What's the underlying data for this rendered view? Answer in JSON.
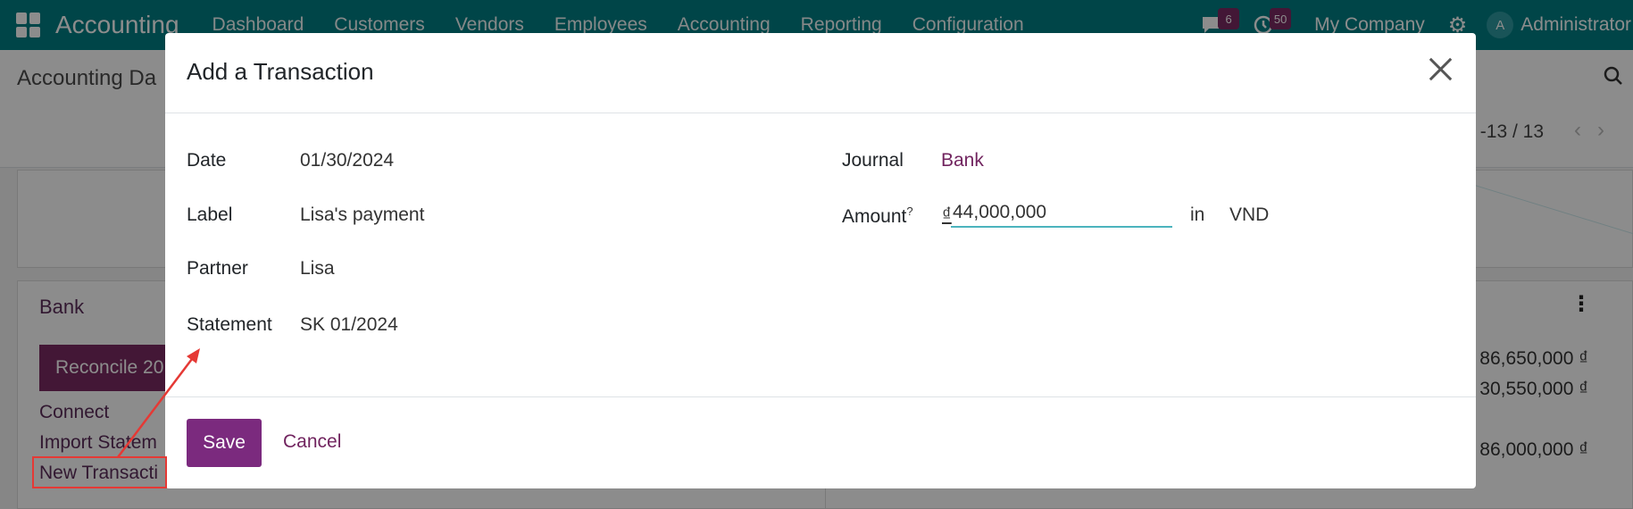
{
  "navbar": {
    "brand": "Accounting",
    "menu": [
      "Dashboard",
      "Customers",
      "Vendors",
      "Employees",
      "Accounting",
      "Reporting",
      "Configuration"
    ],
    "messages_count": "6",
    "activities_count": "50",
    "company": "My Company",
    "avatar_initial": "A",
    "user": "Administrator"
  },
  "background": {
    "page_title": "Accounting Da",
    "pager": "-13 / 13",
    "bank_title": "Bank",
    "reconcile_label": "Reconcile 20",
    "links": [
      "Connect",
      "Import Statem",
      "New Transacti"
    ],
    "amounts": [
      "86,650,000 ₫",
      "30,550,000 ₫",
      "86,000,000 ₫"
    ]
  },
  "modal": {
    "title": "Add a Transaction",
    "date_label": "Date",
    "date_value": "01/30/2024",
    "label_label": "Label",
    "label_value": "Lisa's payment",
    "partner_label": "Partner",
    "partner_value": "Lisa",
    "statement_label": "Statement",
    "statement_value": "SK 01/2024",
    "journal_label": "Journal",
    "journal_value": "Bank",
    "amount_label": "Amount",
    "amount_help": "?",
    "currency_symbol": "₫",
    "amount_value": "44,000,000",
    "in_label": "in",
    "currency": "VND",
    "save_label": "Save",
    "cancel_label": "Cancel"
  },
  "colors": {
    "navbar": "#017e84",
    "primary": "#7b2a7e",
    "link": "#71245f",
    "annotation": "#e53935"
  }
}
